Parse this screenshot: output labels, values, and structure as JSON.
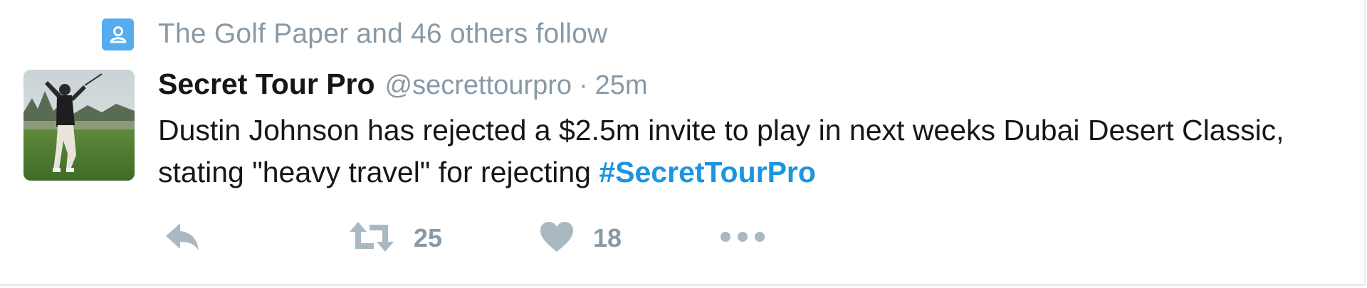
{
  "context": {
    "text": "The Golf Paper and 46 others follow",
    "icon": "person-card-icon"
  },
  "author": {
    "display_name": "Secret Tour Pro",
    "username": "@secrettourpro",
    "separator": "·",
    "time": "25m",
    "avatar_description": "golfer-photo"
  },
  "tweet": {
    "text_before": "Dustin Johnson has rejected a $2.5m invite to play in next weeks Dubai Desert Classic, stating \"heavy travel\" for rejecting ",
    "hashtag": "#SecretTourPro"
  },
  "actions": {
    "reply_icon": "reply-icon",
    "retweet_icon": "retweet-icon",
    "retweet_count": "25",
    "like_icon": "heart-icon",
    "like_count": "18",
    "more_icon": "more-dots-icon"
  },
  "colors": {
    "accent": "#1b95e0",
    "icon_blue": "#55acee",
    "muted": "#8899a6",
    "text": "#14171a",
    "action_icon": "#aab8c2"
  }
}
